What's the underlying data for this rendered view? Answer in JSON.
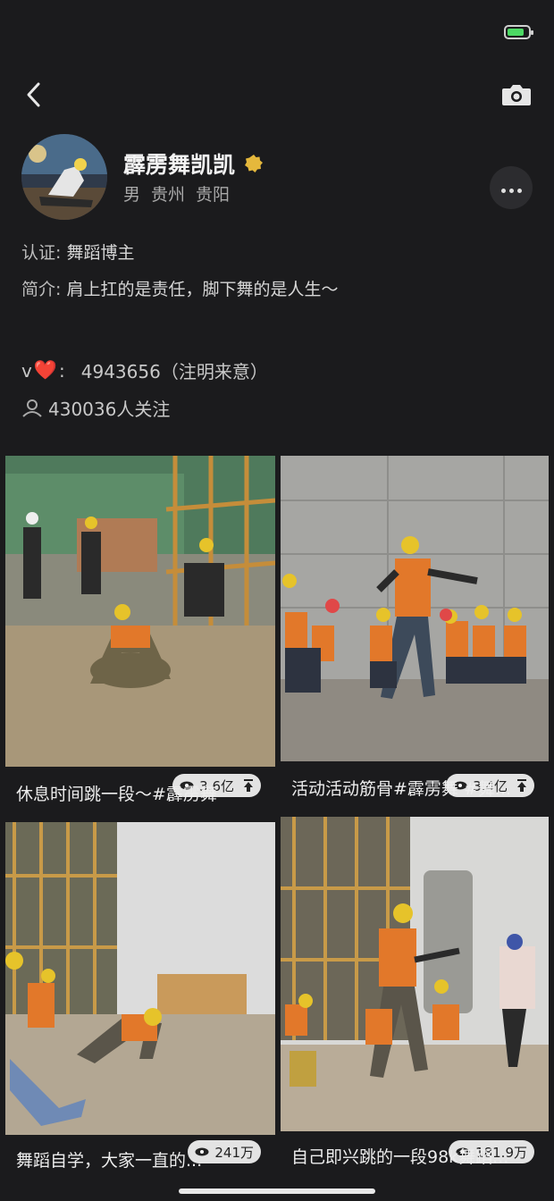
{
  "profile": {
    "name": "霹雳舞凯凯",
    "gender": "男",
    "province": "贵州",
    "city": "贵阳",
    "certification": {
      "label": "认证:",
      "value": "舞蹈博主"
    },
    "bio": {
      "label": "简介:",
      "value": "肩上扛的是责任，脚下舞的是人生～"
    },
    "wechat": {
      "prefix": "v",
      "heart": "❤️",
      "colon": ":",
      "value": "4943656（注明来意）"
    },
    "followers": "430036人关注"
  },
  "colors": {
    "accent_heart": "#ee3b3b",
    "verified": "#e5b83c",
    "battery": "#4cd964"
  },
  "icons": [
    "back-arrow-icon",
    "camera-icon",
    "more-icon",
    "verified-badge-icon",
    "followers-icon",
    "eye-icon",
    "pin-top-icon"
  ],
  "posts": [
    {
      "caption": "休息时间跳一段～#霹雳舞",
      "views": "3.6亿",
      "pinned": true
    },
    {
      "caption": "活动活动筋骨#霹雳舞 #舞...",
      "views": "3.4亿",
      "pinned": true
    },
    {
      "caption": "舞蹈自学，大家一直的...",
      "views": "241万",
      "pinned": false
    },
    {
      "caption": "自己即兴跳的一段98k舞蹈...",
      "views": "181.9万",
      "pinned": false
    }
  ]
}
